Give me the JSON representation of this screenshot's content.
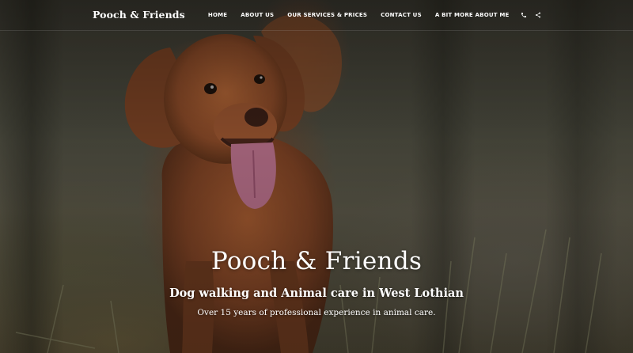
{
  "header": {
    "brand": "Pooch & Friends",
    "nav": [
      {
        "label": "HOME"
      },
      {
        "label": "ABOUT US"
      },
      {
        "label": "OUR SERVICES & PRICES"
      },
      {
        "label": "CONTACT US"
      },
      {
        "label": "A BIT MORE ABOUT ME"
      }
    ],
    "icons": [
      "phone-icon",
      "share-icon"
    ]
  },
  "hero": {
    "title": "Pooch & Friends",
    "subtitle": "Dog walking and Animal care in West Lothian",
    "tagline": "Over 15 years of professional experience in animal care."
  },
  "colors": {
    "text": "#ffffff",
    "dog_fur": "#8a4a28",
    "tongue": "#b8708a"
  }
}
